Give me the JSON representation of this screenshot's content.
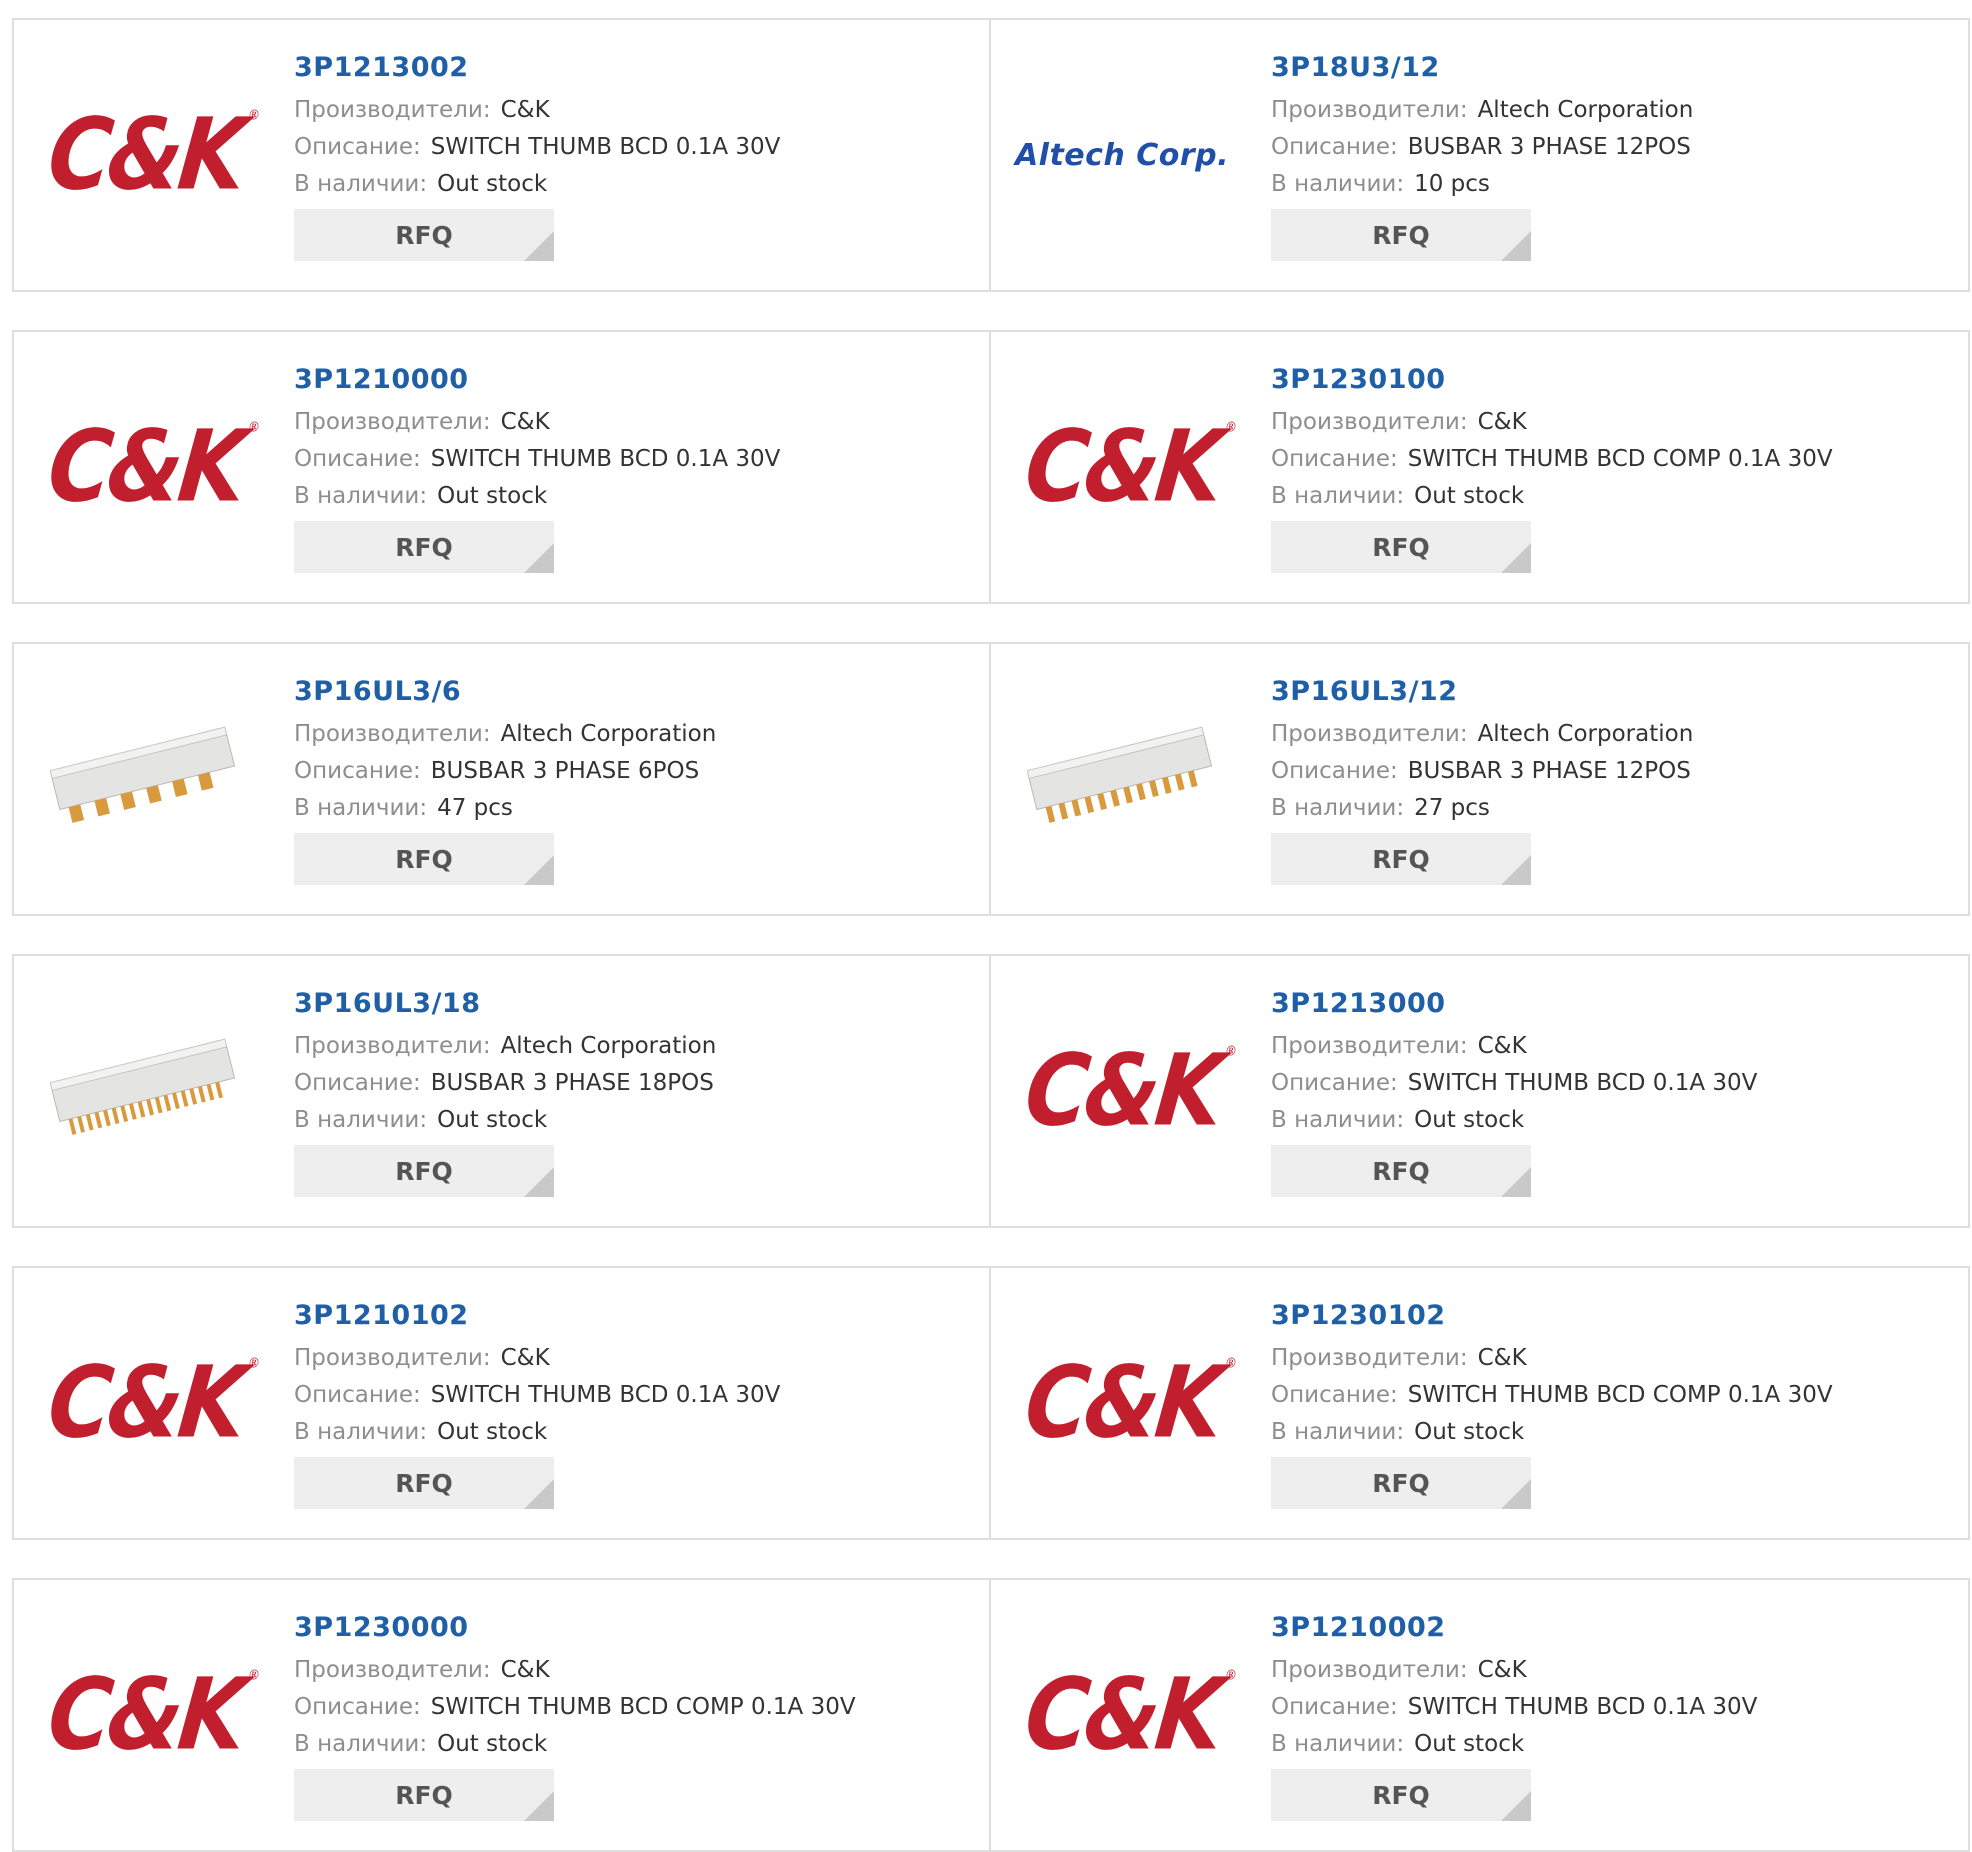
{
  "labels": {
    "manufacturer": "Производители:",
    "description": "Описание:",
    "stock": "В наличии:",
    "rfq": "RFQ"
  },
  "brands": {
    "ck": "C&K",
    "altech": "Altech Corp."
  },
  "colors": {
    "part_link": "#1f5fa5",
    "label": "#8e8e8e",
    "value": "#333333",
    "ck_red": "#c21f2e",
    "altech_blue": "#1f4fa8",
    "rfq_bg": "#eeeeee"
  },
  "rows": [
    [
      {
        "part": "3P1213002",
        "image": "ck-logo",
        "manufacturer": "C&K",
        "description": "SWITCH THUMB BCD 0.1A 30V",
        "stock": "Out stock"
      },
      {
        "part": "3P18U3/12",
        "image": "altech-logo",
        "manufacturer": "Altech Corporation",
        "description": "BUSBAR 3 PHASE 12POS",
        "stock": "10 pcs"
      }
    ],
    [
      {
        "part": "3P1210000",
        "image": "ck-logo",
        "manufacturer": "C&K",
        "description": "SWITCH THUMB BCD 0.1A 30V",
        "stock": "Out stock"
      },
      {
        "part": "3P1230100",
        "image": "ck-logo",
        "manufacturer": "C&K",
        "description": "SWITCH THUMB BCD COMP 0.1A 30V",
        "stock": "Out stock"
      }
    ],
    [
      {
        "part": "3P16UL3/6",
        "image": "busbar-6-photo",
        "manufacturer": "Altech Corporation",
        "description": "BUSBAR 3 PHASE 6POS",
        "stock": "47 pcs"
      },
      {
        "part": "3P16UL3/12",
        "image": "busbar-12-photo",
        "manufacturer": "Altech Corporation",
        "description": "BUSBAR 3 PHASE 12POS",
        "stock": "27 pcs"
      }
    ],
    [
      {
        "part": "3P16UL3/18",
        "image": "busbar-18-photo",
        "manufacturer": "Altech Corporation",
        "description": "BUSBAR 3 PHASE 18POS",
        "stock": "Out stock"
      },
      {
        "part": "3P1213000",
        "image": "ck-logo",
        "manufacturer": "C&K",
        "description": "SWITCH THUMB BCD 0.1A 30V",
        "stock": "Out stock"
      }
    ],
    [
      {
        "part": "3P1210102",
        "image": "ck-logo",
        "manufacturer": "C&K",
        "description": "SWITCH THUMB BCD 0.1A 30V",
        "stock": "Out stock"
      },
      {
        "part": "3P1230102",
        "image": "ck-logo",
        "manufacturer": "C&K",
        "description": "SWITCH THUMB BCD COMP 0.1A 30V",
        "stock": "Out stock"
      }
    ],
    [
      {
        "part": "3P1230000",
        "image": "ck-logo",
        "manufacturer": "C&K",
        "description": "SWITCH THUMB BCD COMP 0.1A 30V",
        "stock": "Out stock"
      },
      {
        "part": "3P1210002",
        "image": "ck-logo",
        "manufacturer": "C&K",
        "description": "SWITCH THUMB BCD 0.1A 30V",
        "stock": "Out stock"
      }
    ]
  ]
}
